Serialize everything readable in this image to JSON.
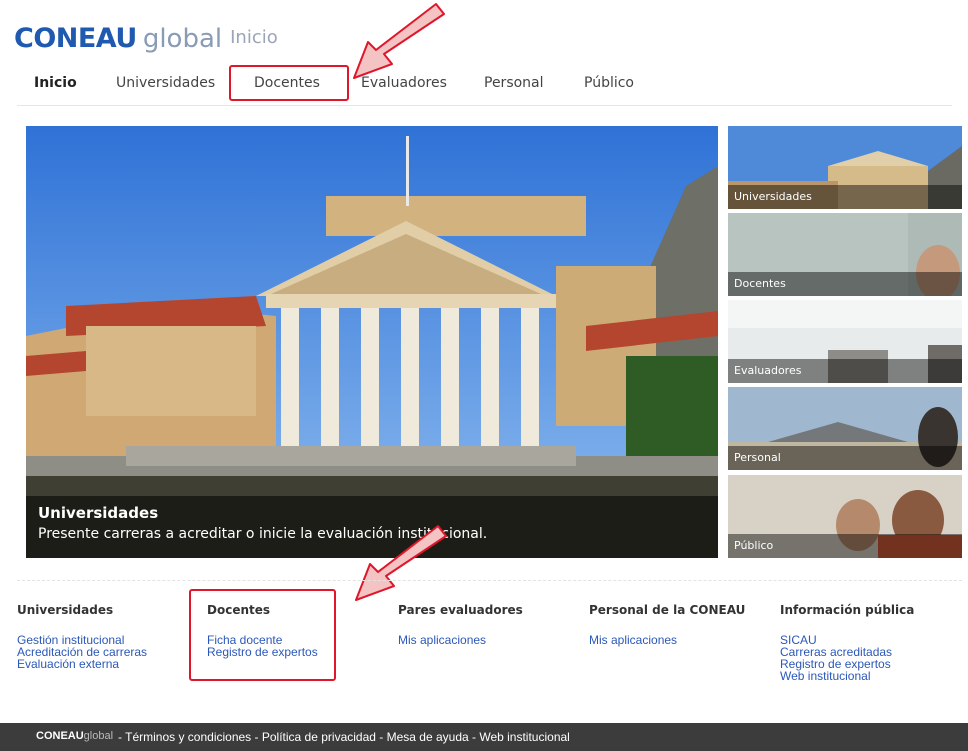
{
  "header": {
    "logo_brand": "CONEAU",
    "logo_suffix": "global",
    "page_name": "Inicio"
  },
  "nav": {
    "items": [
      {
        "label": "Inicio"
      },
      {
        "label": "Universidades"
      },
      {
        "label": "Docentes"
      },
      {
        "label": "Evaluadores"
      },
      {
        "label": "Personal"
      },
      {
        "label": "Público"
      }
    ]
  },
  "hero": {
    "title": "Universidades",
    "subtitle": "Presente carreras a acreditar o inicie la evaluación institucional."
  },
  "thumbs": [
    {
      "label": "Universidades"
    },
    {
      "label": "Docentes"
    },
    {
      "label": "Evaluadores"
    },
    {
      "label": "Personal"
    },
    {
      "label": "Público"
    }
  ],
  "columns": [
    {
      "title": "Universidades",
      "links": [
        "Gestión institucional",
        "Acreditación de carreras",
        "Evaluación externa"
      ]
    },
    {
      "title": "Docentes",
      "links": [
        "Ficha docente",
        "Registro de expertos"
      ]
    },
    {
      "title": "Pares evaluadores",
      "links": [
        "Mis aplicaciones"
      ]
    },
    {
      "title": "Personal de la CONEAU",
      "links": [
        "Mis aplicaciones"
      ]
    },
    {
      "title": "Información pública",
      "links": [
        "SICAU",
        "Carreras acreditadas",
        "Registro de expertos",
        "Web institucional"
      ]
    }
  ],
  "footer": {
    "logo_brand": "CONEAU",
    "logo_suffix": "global",
    "links": [
      "Términos y condiciones",
      "Política de privacidad",
      "Mesa de ayuda",
      "Web institucional"
    ],
    "separator": " - "
  },
  "colors": {
    "brand": "#1f59b0",
    "link": "#2b58b8",
    "highlight": "#e0162b",
    "footer": "#3c3c3c"
  }
}
